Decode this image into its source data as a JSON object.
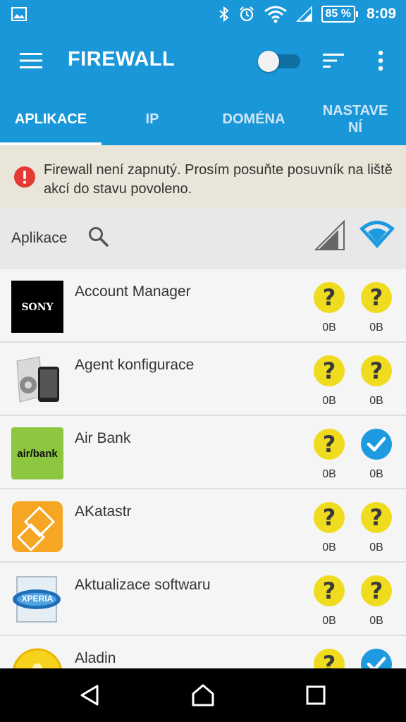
{
  "status_bar": {
    "battery": "85 %",
    "time": "8:09",
    "icons": [
      "image-icon",
      "bluetooth-icon",
      "alarm-icon",
      "wifi-icon",
      "cell-signal-icon",
      "battery-icon"
    ]
  },
  "app_bar": {
    "title": "FIREWALL",
    "icons": [
      "menu-icon",
      "toggle",
      "sort-icon",
      "more-icon"
    ]
  },
  "tabs": [
    {
      "label": "APLIKACE",
      "active": true
    },
    {
      "label": "IP",
      "active": false
    },
    {
      "label": "DOMÉNA",
      "active": false
    },
    {
      "label": "NASTAVENÍ",
      "line1": "NASTAVE",
      "line2": "NÍ",
      "active": false
    }
  ],
  "banner": {
    "text": "Firewall není zapnutý. Prosím posuňte posuvník na liště akcí do stavu povoleno.",
    "icon": "error-icon"
  },
  "list_header": {
    "label": "Aplikace",
    "icons": [
      "search-icon",
      "mobile-signal-icon",
      "wifi-icon"
    ]
  },
  "apps": [
    {
      "name": "Account Manager",
      "icon": "sony-icon",
      "mobile": {
        "status": "unknown",
        "size": "0B"
      },
      "wifi": {
        "status": "unknown",
        "size": "0B"
      }
    },
    {
      "name": "Agent konfigurace",
      "icon": "config-agent-icon",
      "mobile": {
        "status": "unknown",
        "size": "0B"
      },
      "wifi": {
        "status": "unknown",
        "size": "0B"
      }
    },
    {
      "name": "Air Bank",
      "icon": "airbank-icon",
      "icon_text": "air/bank",
      "mobile": {
        "status": "unknown",
        "size": "0B"
      },
      "wifi": {
        "status": "allowed",
        "size": "0B"
      }
    },
    {
      "name": "AKatastr",
      "icon": "akatastr-icon",
      "mobile": {
        "status": "unknown",
        "size": "0B"
      },
      "wifi": {
        "status": "unknown",
        "size": "0B"
      }
    },
    {
      "name": "Aktualizace softwaru",
      "icon": "xperia-icon",
      "icon_text": "XPERIA",
      "mobile": {
        "status": "unknown",
        "size": "0B"
      },
      "wifi": {
        "status": "unknown",
        "size": "0B"
      }
    },
    {
      "name": "Aladin",
      "icon": "aladin-icon",
      "mobile": {
        "status": "unknown",
        "size": ""
      },
      "wifi": {
        "status": "allowed",
        "size": ""
      }
    }
  ],
  "colors": {
    "primary": "#1a97d9",
    "unknown": "#f0dc1e",
    "allowed": "#1e9be0",
    "banner_bg": "#e9e5d8",
    "error": "#e53935"
  },
  "nav_bar": {
    "icons": [
      "back-icon",
      "home-icon",
      "recents-icon"
    ]
  }
}
